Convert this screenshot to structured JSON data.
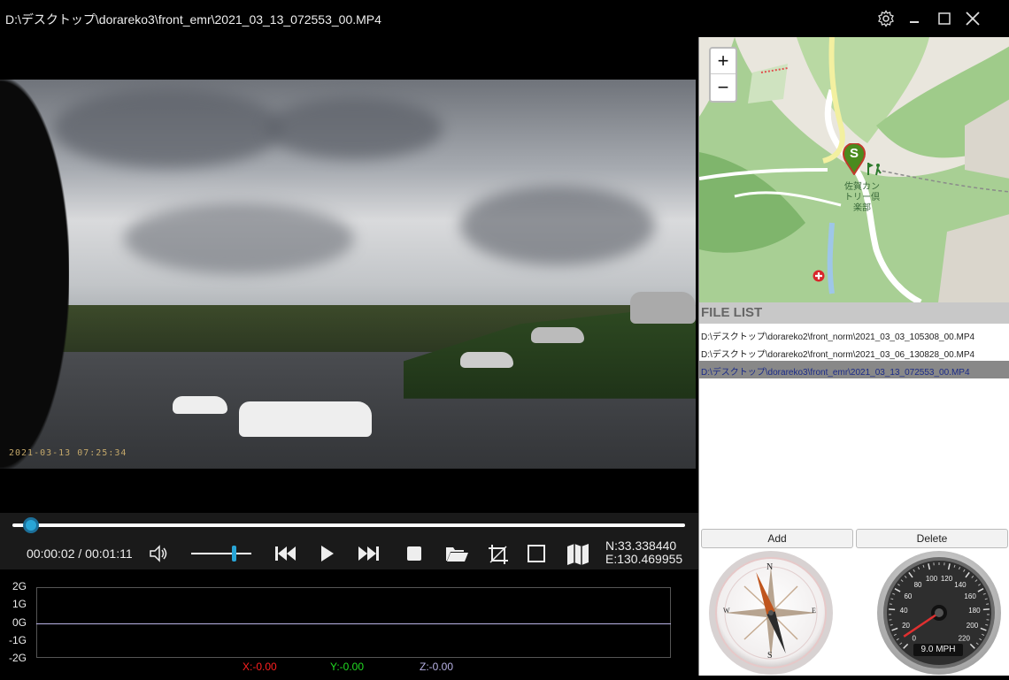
{
  "window": {
    "title": "D:\\デスクトップ\\dorareko3\\front_emr\\2021_03_13_072553_00.MP4"
  },
  "video": {
    "timestamp_overlay": "2021-03-13  07:25:34"
  },
  "playback": {
    "current_time": "00:00:02",
    "separator": "/",
    "total_time": "00:01:11",
    "progress_fraction": 0.028,
    "volume_fraction": 0.7
  },
  "gps": {
    "north": "N:33.338440",
    "east": "E:130.469955"
  },
  "gsensor": {
    "y_labels": [
      "2G",
      "1G",
      "0G",
      "-1G",
      "-2G"
    ],
    "x_value": "X:-0.00",
    "y_value": "Y:-0.00",
    "z_value": "Z:-0.00",
    "colors": {
      "x": "#ff2020",
      "y": "#22dd22",
      "z": "#b9b3e6"
    }
  },
  "map": {
    "zoom_in": "+",
    "zoom_out": "−",
    "marker_label": "S",
    "place_name_1": "佐賀カン",
    "place_name_2": "トリー倶",
    "place_name_3": "楽部"
  },
  "file_list": {
    "header": "FILE LIST",
    "files": [
      "D:\\デスクトップ\\dorareko2\\front_norm\\2021_03_03_105308_00.MP4",
      "D:\\デスクトップ\\dorareko2\\front_norm\\2021_03_06_130828_00.MP4",
      "D:\\デスクトップ\\dorareko3\\front_emr\\2021_03_13_072553_00.MP4"
    ],
    "selected_index": 2,
    "add_label": "Add",
    "delete_label": "Delete"
  },
  "compass": {
    "n": "N",
    "s": "S",
    "e": "E",
    "w": "W",
    "heading_deg": 160
  },
  "speedometer": {
    "ticks": [
      "0",
      "20",
      "40",
      "60",
      "80",
      "100",
      "120",
      "140",
      "160",
      "180",
      "200",
      "220"
    ],
    "readout": "9.0 MPH",
    "speed": 9
  },
  "colors": {
    "accent": "#29a5d6",
    "selected_file_text": "#1b2b88"
  }
}
